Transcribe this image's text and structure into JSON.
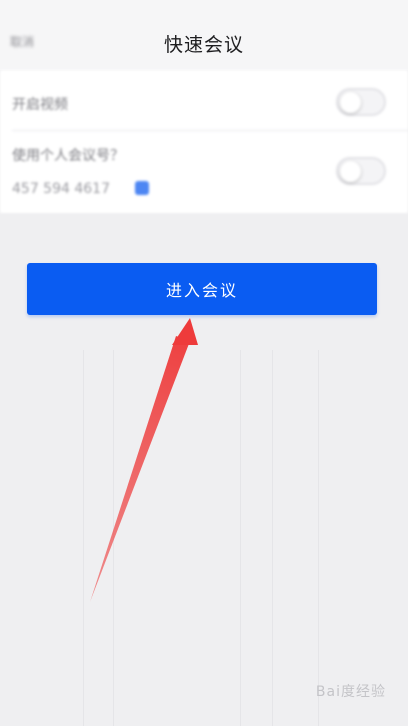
{
  "header": {
    "back_label": "取消",
    "title": "快速会议"
  },
  "settings": {
    "video_label": "开启视频",
    "video_enabled": false,
    "personal_meeting_label": "使用个人会议号？",
    "personal_meeting_enabled": false,
    "meeting_id": "457 594 4617"
  },
  "actions": {
    "join_label": "进入会议"
  },
  "watermark": {
    "text": "Bai度经验"
  },
  "colors": {
    "primary": "#0a5cf2",
    "annotation_arrow": "#ee3b3b",
    "status_indicator": "#7fe0a8"
  }
}
